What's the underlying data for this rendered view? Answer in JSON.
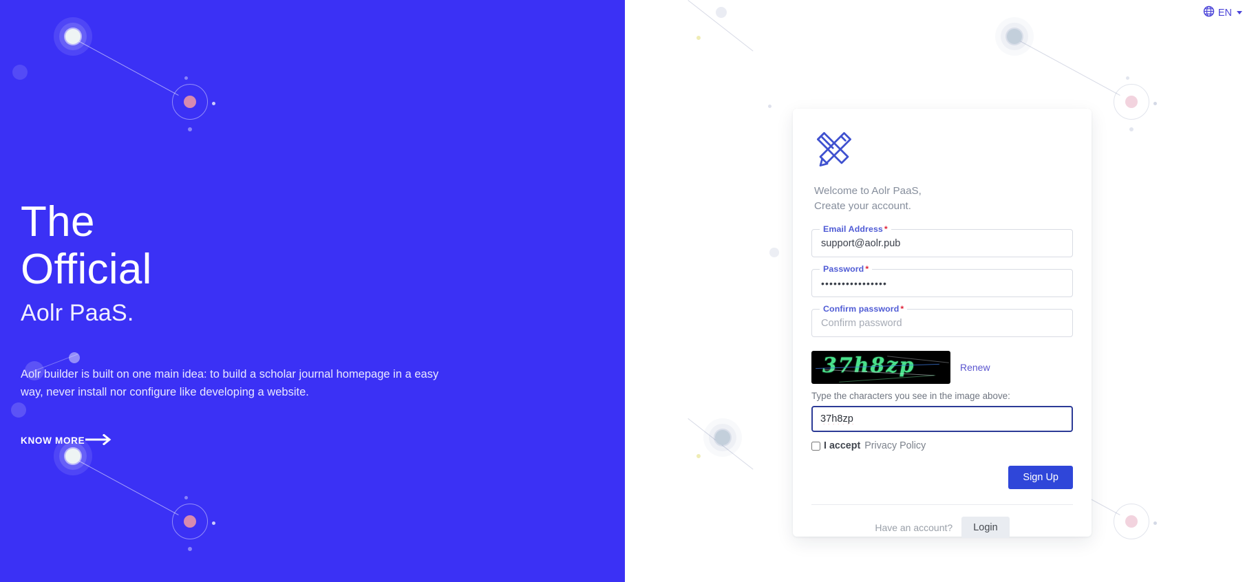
{
  "theme": {
    "hero_blue": "#3b31f5",
    "accent_blue": "#2f46d9",
    "label_blue": "#4f5bd5",
    "required_red": "#e0243a",
    "captcha_green": "#49e08a",
    "focus_border": "#2b3a96"
  },
  "lang": {
    "icon": "globe-icon",
    "code": "EN",
    "caret": "chevron-down-icon"
  },
  "hero": {
    "title_line1": "The",
    "title_line2": "Official",
    "title_line3": "Aolr PaaS.",
    "description": "Aolr builder is built on one main idea: to build a scholar journal homepage in a easy way, never install nor configure like developing a website.",
    "cta_label": "KNOW MORE",
    "cta_icon": "arrow-right-icon"
  },
  "card": {
    "logo_icon": "ruler-pencil-logo-icon",
    "welcome_line1": "Welcome to Aolr PaaS,",
    "welcome_line2": "Create your account.",
    "fields": [
      {
        "name": "email",
        "label": "Email Address",
        "required_mark": "*",
        "value": "support@aolr.pub",
        "placeholder": "Email Address",
        "type": "text"
      },
      {
        "name": "password",
        "label": "Password",
        "required_mark": "*",
        "value": "••••••••••••••••",
        "placeholder": "Password",
        "type": "password"
      },
      {
        "name": "confirm-password",
        "label": "Confirm password",
        "required_mark": "*",
        "value": "",
        "placeholder": "Confirm password",
        "type": "password"
      }
    ],
    "captcha": {
      "image_text": "37h8zp",
      "renew_label": "Renew",
      "hint": "Type the characters you see in the image above:",
      "input_value": "37h8zp",
      "input_placeholder": "Type the characters"
    },
    "privacy": {
      "accept_text": "I accept",
      "link_text": "Privacy Policy",
      "checked": false
    },
    "signup_label": "Sign Up",
    "have_account_text": "Have an account?",
    "login_label": "Login"
  }
}
